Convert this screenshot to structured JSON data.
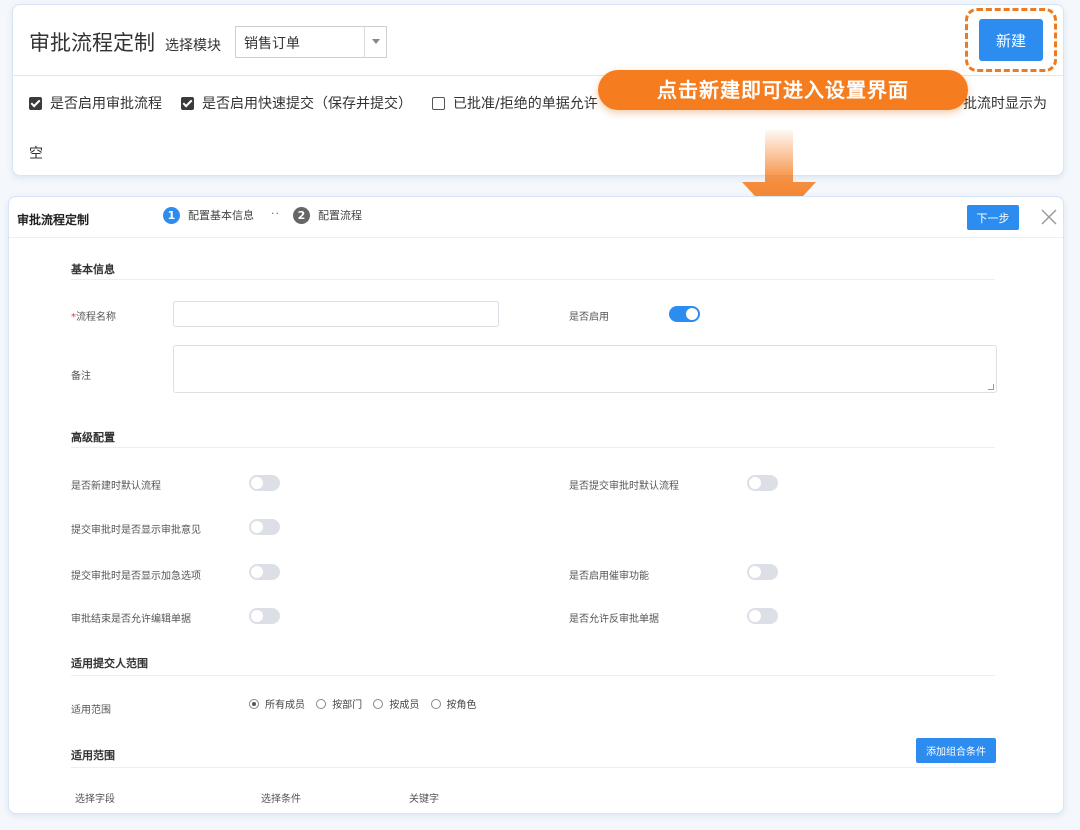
{
  "top": {
    "title": "审批流程定制",
    "module_label": "选择模块",
    "module_value": "销售订单",
    "new_button": "新建",
    "checkboxes": [
      {
        "label": "是否启用审批流程",
        "checked": true
      },
      {
        "label": "是否启用快速提交（保存并提交）",
        "checked": true
      },
      {
        "label": "已批准/拒绝的单据允许",
        "checked": false
      }
    ],
    "overflow_text": "批流时显示为",
    "continued_text": "空"
  },
  "annotation": {
    "text": "点击新建即可进入设置界面",
    "color": "#f57c1f"
  },
  "dialog": {
    "title": "审批流程定制",
    "steps": [
      {
        "num": "1",
        "label": "配置基本信息",
        "active": true
      },
      {
        "num": "2",
        "label": "配置流程",
        "active": false
      }
    ],
    "step_separator": "··",
    "next_button": "下一步",
    "basic": {
      "section": "基本信息",
      "name_label": "流程名称",
      "name_required": "*",
      "name_value": "",
      "enable_label": "是否启用",
      "enable_on": true,
      "remark_label": "备注",
      "remark_value": ""
    },
    "advanced": {
      "section": "高级配置",
      "items": [
        {
          "label": "是否新建时默认流程",
          "on": false
        },
        {
          "label": "是否提交审批时默认流程",
          "on": false
        },
        {
          "label": "提交审批时是否显示审批意见",
          "on": false
        },
        {
          "label": "提交审批时是否显示加急选项",
          "on": false
        },
        {
          "label": "是否启用催审功能",
          "on": false
        },
        {
          "label": "审批结束是否允许编辑单据",
          "on": false
        },
        {
          "label": "是否允许反审批单据",
          "on": false
        }
      ]
    },
    "submitter": {
      "section": "适用提交人范围",
      "scope_label": "适用范围",
      "options": [
        {
          "label": "所有成员",
          "selected": true
        },
        {
          "label": "按部门",
          "selected": false
        },
        {
          "label": "按成员",
          "selected": false
        },
        {
          "label": "按角色",
          "selected": false
        }
      ]
    },
    "scope": {
      "section": "适用范围",
      "add_button": "添加组合条件",
      "columns": [
        "选择字段",
        "选择条件",
        "关键字"
      ]
    }
  },
  "colors": {
    "primary": "#2d8cf0",
    "accent_orange": "#f57c1f",
    "required": "#e4393c"
  }
}
